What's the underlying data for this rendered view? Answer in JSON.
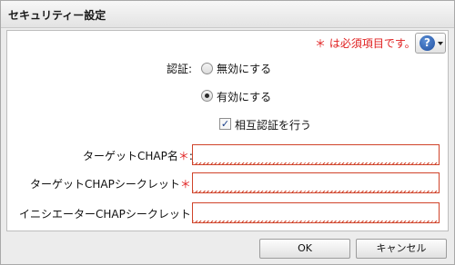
{
  "dialog": {
    "title": "セキュリティー設定"
  },
  "header": {
    "required_note": "＊ は必須項目です。",
    "help_icon_glyph": "?"
  },
  "auth": {
    "label": "認証:",
    "options": [
      {
        "label": "無効にする",
        "selected": false
      },
      {
        "label": "有効にする",
        "selected": true
      }
    ],
    "mutual": {
      "label": "相互認証を行う",
      "checked": true,
      "check_glyph": "✓"
    }
  },
  "fields": {
    "target_chap_name": {
      "label": "ターゲットCHAP名",
      "asterisk": "＊",
      "colon": ":",
      "value": ""
    },
    "target_chap_secret": {
      "label": "ターゲットCHAPシークレット",
      "asterisk": "＊",
      "colon": ":",
      "value": ""
    },
    "initiator_chap_secret": {
      "label": "イニシエーターCHAPシークレット:",
      "value": ""
    }
  },
  "buttons": {
    "ok": "OK",
    "cancel": "キャンセル"
  },
  "colors": {
    "required": "#e01e1e",
    "field_border": "#d0432a",
    "help_icon": "#1f4fa0"
  }
}
